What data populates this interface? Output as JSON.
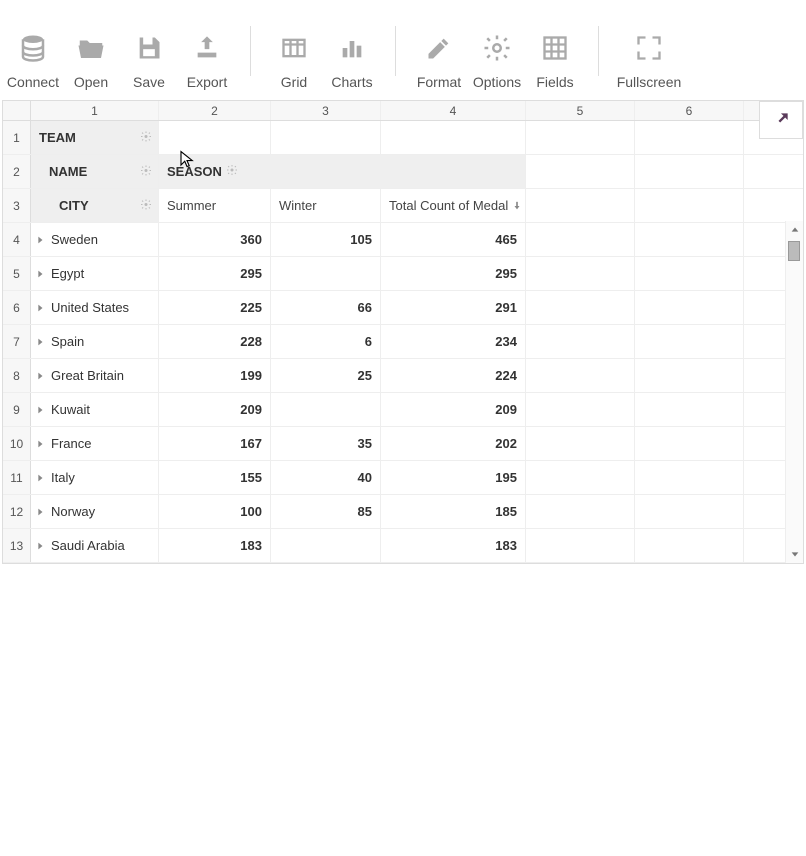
{
  "toolbar": {
    "connect": "Connect",
    "open": "Open",
    "save": "Save",
    "export": "Export",
    "grid": "Grid",
    "charts": "Charts",
    "format": "Format",
    "options": "Options",
    "fields": "Fields",
    "fullscreen": "Fullscreen"
  },
  "col_headers": [
    "1",
    "2",
    "3",
    "4",
    "5",
    "6"
  ],
  "hierarchy": {
    "team": "TEAM",
    "name": "NAME",
    "city": "CITY",
    "season": "SEASON"
  },
  "season_cols": {
    "summer": "Summer",
    "winter": "Winter",
    "total": "Total Count of Medal"
  },
  "rows": [
    {
      "n": "4",
      "team": "Sweden",
      "summer": "360",
      "winter": "105",
      "total": "465"
    },
    {
      "n": "5",
      "team": "Egypt",
      "summer": "295",
      "winter": "",
      "total": "295"
    },
    {
      "n": "6",
      "team": "United States",
      "summer": "225",
      "winter": "66",
      "total": "291"
    },
    {
      "n": "7",
      "team": "Spain",
      "summer": "228",
      "winter": "6",
      "total": "234"
    },
    {
      "n": "8",
      "team": "Great Britain",
      "summer": "199",
      "winter": "25",
      "total": "224"
    },
    {
      "n": "9",
      "team": "Kuwait",
      "summer": "209",
      "winter": "",
      "total": "209"
    },
    {
      "n": "10",
      "team": "France",
      "summer": "167",
      "winter": "35",
      "total": "202"
    },
    {
      "n": "11",
      "team": "Italy",
      "summer": "155",
      "winter": "40",
      "total": "195"
    },
    {
      "n": "12",
      "team": "Norway",
      "summer": "100",
      "winter": "85",
      "total": "185"
    },
    {
      "n": "13",
      "team": "Saudi Arabia",
      "summer": "183",
      "winter": "",
      "total": "183"
    }
  ]
}
